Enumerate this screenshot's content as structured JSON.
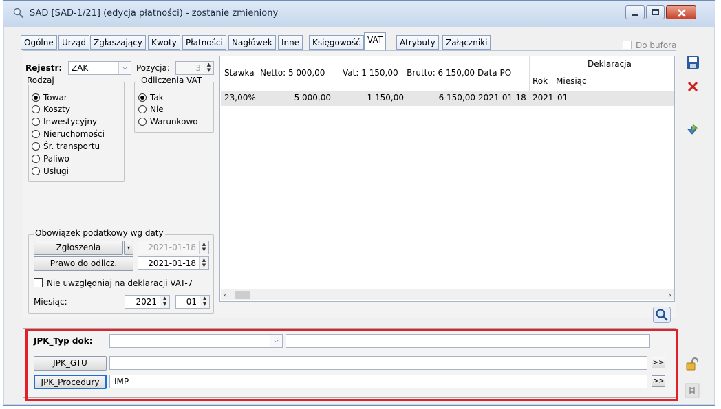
{
  "window": {
    "title": "SAD [SAD-1/21] (edycja płatności) - zostanie zmieniony"
  },
  "tabs": [
    {
      "label": "Ogólne"
    },
    {
      "label": "Urząd"
    },
    {
      "label": "Zgłaszający"
    },
    {
      "label": "Kwoty"
    },
    {
      "label": "Płatności"
    },
    {
      "label": "Nagłówek"
    },
    {
      "label": "Inne"
    },
    {
      "label": "Księgowość"
    },
    {
      "label": "VAT"
    },
    {
      "label": "Atrybuty"
    },
    {
      "label": "Załączniki"
    }
  ],
  "do_bufora": "Do bufora",
  "vat": {
    "rejestr_label": "Rejestr:",
    "rejestr_value": "ZAK",
    "pozycja_label": "Pozycja:",
    "pozycja_value": "3",
    "rodzaj_label": "Rodzaj",
    "rodzaj_options": [
      "Towar",
      "Koszty",
      "Inwestycyjny",
      "Nieruchomości",
      "Śr. transportu",
      "Paliwo",
      "Usługi"
    ],
    "odliczenia_label": "Odliczenia VAT",
    "odliczenia_options": [
      "Tak",
      "Nie",
      "Warunkowo"
    ],
    "obowiazek_label": "Obowiązek podatkowy wg daty",
    "zgloszenia_btn": "Zgłoszenia",
    "zgloszenia_date": "2021-01-18",
    "prawo_btn": "Prawo do odlicz.",
    "prawo_date": "2021-01-18",
    "nie_uwzgledniaj": "Nie uwzględniaj na deklaracji VAT-7",
    "miesiac_label": "Miesiąc:",
    "miesiac_year": "2021",
    "miesiac_month": "01"
  },
  "grid": {
    "headers": {
      "stawka": "Stawka",
      "netto": "Netto: 5 000,00",
      "vat": "Vat: 1 150,00",
      "brutto": "Brutto: 6 150,00",
      "data_po": "Data PO",
      "deklaracja": "Deklaracja",
      "rok": "Rok",
      "miesiac": "Miesiąc"
    },
    "rows": [
      {
        "stawka": "23,00%",
        "netto": "5 000,00",
        "vat": "1 150,00",
        "brutto": "6 150,00",
        "data_po": "2021-01-18",
        "rok": "2021",
        "miesiac": "01"
      }
    ]
  },
  "jpk": {
    "typ_label": "JPK_Typ dok:",
    "gtu_btn": "JPK_GTU",
    "gtu_value": "",
    "procedury_btn": "JPK_Procedury",
    "procedury_value": "IMP",
    "more": ">>"
  },
  "colors": {
    "highlight": "#e2202b",
    "accent": "#1e6fd6"
  }
}
